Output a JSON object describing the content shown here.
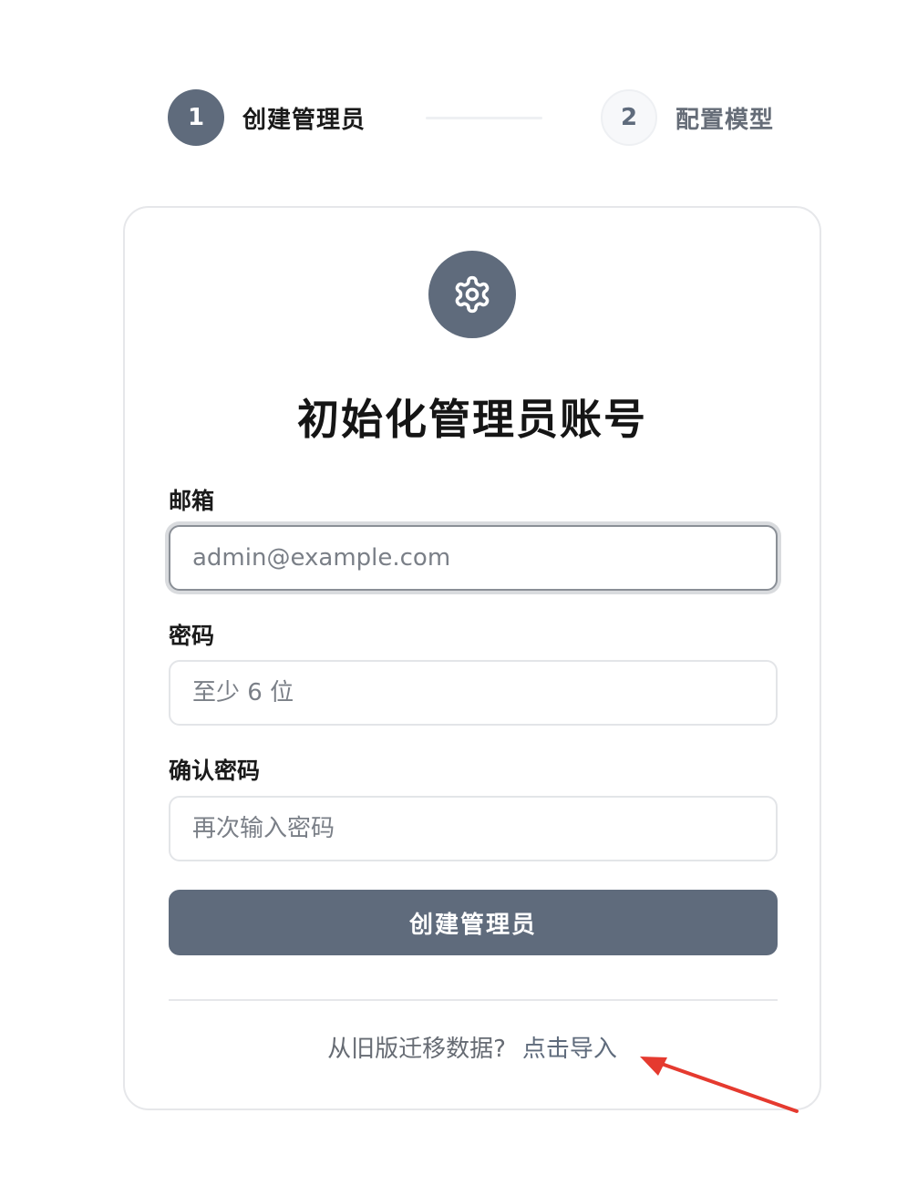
{
  "stepper": {
    "steps": [
      {
        "number": "1",
        "label": "创建管理员",
        "active": true
      },
      {
        "number": "2",
        "label": "配置模型",
        "active": false
      }
    ]
  },
  "card": {
    "icon": "gear-icon",
    "title": "初始化管理员账号",
    "fields": [
      {
        "label": "邮箱",
        "placeholder": "admin@example.com",
        "value": "",
        "focused": true
      },
      {
        "label": "密码",
        "placeholder": "至少 6 位",
        "value": ""
      },
      {
        "label": "确认密码",
        "placeholder": "再次输入密码",
        "value": ""
      }
    ],
    "submit_label": "创建管理员",
    "footer_text": "从旧版迁移数据?",
    "footer_link": "点击导入"
  },
  "colors": {
    "accent": "#5f6b7c",
    "annotation_arrow": "#e53a2f"
  },
  "annotation": {
    "icon": "red-arrow-icon"
  }
}
